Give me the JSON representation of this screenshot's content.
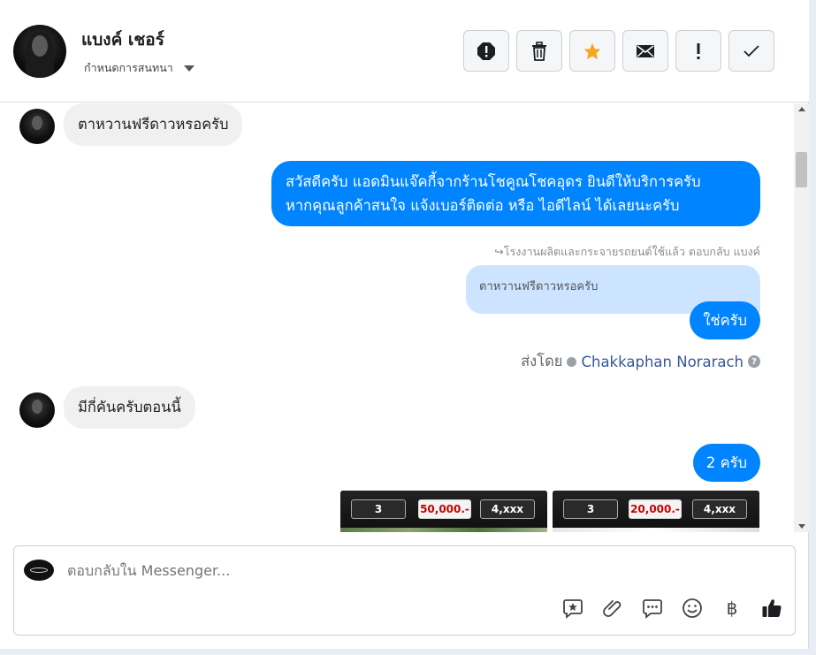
{
  "contact": {
    "name": "แบงค์ เชอร์",
    "assign_label": "กำหนดการสนทนา"
  },
  "toolbar": {
    "buttons": [
      {
        "name": "spam-icon",
        "color": "#1c1e21"
      },
      {
        "name": "trash-icon",
        "color": "#1c1e21"
      },
      {
        "name": "star-icon",
        "color": "#f5a623"
      },
      {
        "name": "mail-icon",
        "color": "#1c1e21"
      },
      {
        "name": "follow-up-icon",
        "color": "#1c1e21"
      },
      {
        "name": "check-icon",
        "color": "#1c1e21"
      }
    ]
  },
  "messages": {
    "m1": "ตาหวานฟรีดาวหรอครับ",
    "m2_line1": "สวัสดีครับ แอดมินแจ๊คกี้จากร้านโชคูณโชคอุดร ยินดีให้บริการครับ",
    "m2_line2": "หากคุณลูกค้าสนใจ แจ้งเบอร์ติดต่อ หรือ ไอดีไลน์ ได้เลยนะครับ",
    "reply_note": "โรงงานผลิตและกระจายรถยนต์ใช้แล้ว ตอบกลับ แบงค์",
    "quoted": "ตาหวานฟรีดาวหรอครับ",
    "m3": "ใช่ครับ",
    "sent_by_label": "ส่งโดย",
    "sent_by_agent": "Chakkaphan Norarach",
    "m4": "มีกี่คันครับตอนนี้",
    "m5": "2 ครับ"
  },
  "images": [
    {
      "months": "3",
      "price": "50,000.-",
      "monthly": "4,xxx"
    },
    {
      "months": "3",
      "price": "20,000.-",
      "monthly": "4,xxx"
    }
  ],
  "composer": {
    "placeholder": "ตอบกลับใน Messenger...",
    "baht_symbol": "฿",
    "accent": "#0084ff"
  }
}
